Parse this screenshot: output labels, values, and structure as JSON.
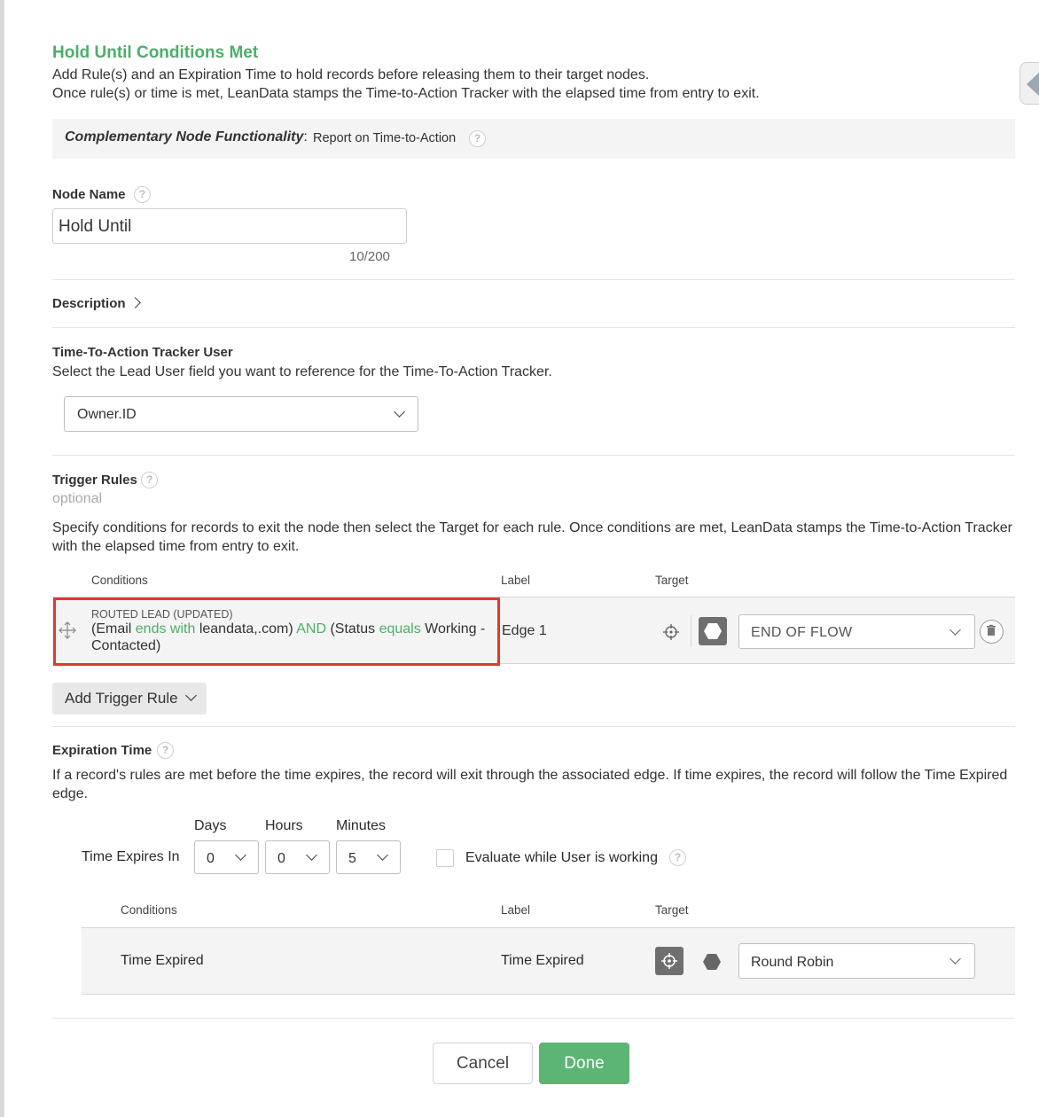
{
  "header": {
    "title": "Hold Until Conditions Met",
    "line1": "Add Rule(s) and an Expiration Time to hold records before releasing them to their target nodes.",
    "line2": "Once rule(s) or time is met, LeanData stamps the Time-to-Action Tracker with the elapsed time from entry to exit."
  },
  "complementary": {
    "label": "Complementary Node Functionality",
    "colon": ":",
    "text": "Report on Time-to-Action"
  },
  "node_name": {
    "label": "Node Name",
    "value": "Hold Until",
    "counter": "10/200"
  },
  "description": {
    "label": "Description"
  },
  "tracker": {
    "label": "Time-To-Action Tracker User",
    "hint": "Select the Lead User field you want to reference for the Time-To-Action Tracker.",
    "selected": "Owner.ID"
  },
  "trigger_rules": {
    "label": "Trigger Rules",
    "optional": "optional",
    "hint": "Specify conditions for records to exit the node then select the Target for each rule. Once conditions are met, LeanData stamps the Time-to-Action Tracker with the elapsed time from entry to exit.",
    "columns": {
      "conditions": "Conditions",
      "label": "Label",
      "target": "Target"
    },
    "rule": {
      "object": "ROUTED LEAD (UPDATED)",
      "p1": "(Email ",
      "op1": "ends with",
      "p2": " leandata,.com) ",
      "and": "AND",
      "p3": " (Status ",
      "op2": "equals",
      "p4": " Working - Contacted)",
      "edge_label": "Edge 1",
      "target": "END OF FLOW"
    },
    "add_button": "Add Trigger Rule"
  },
  "expiration": {
    "label": "Expiration Time",
    "hint": "If a record's rules are met before the time expires, the record will exit through the associated edge. If time expires, the record will follow the Time Expired edge.",
    "expires_label": "Time Expires In",
    "days_label": "Days",
    "hours_label": "Hours",
    "minutes_label": "Minutes",
    "days": "0",
    "hours": "0",
    "minutes": "5",
    "evaluate_label": "Evaluate while User is working",
    "columns": {
      "conditions": "Conditions",
      "label": "Label",
      "target": "Target"
    },
    "row": {
      "condition": "Time Expired",
      "label": "Time Expired",
      "target": "Round Robin"
    }
  },
  "footer": {
    "cancel": "Cancel",
    "done": "Done"
  },
  "icons": {
    "help": "?"
  },
  "colors": {
    "accent_green": "#4caf6a",
    "done_button": "#5cb574",
    "highlight_box": "#e03a2e"
  }
}
